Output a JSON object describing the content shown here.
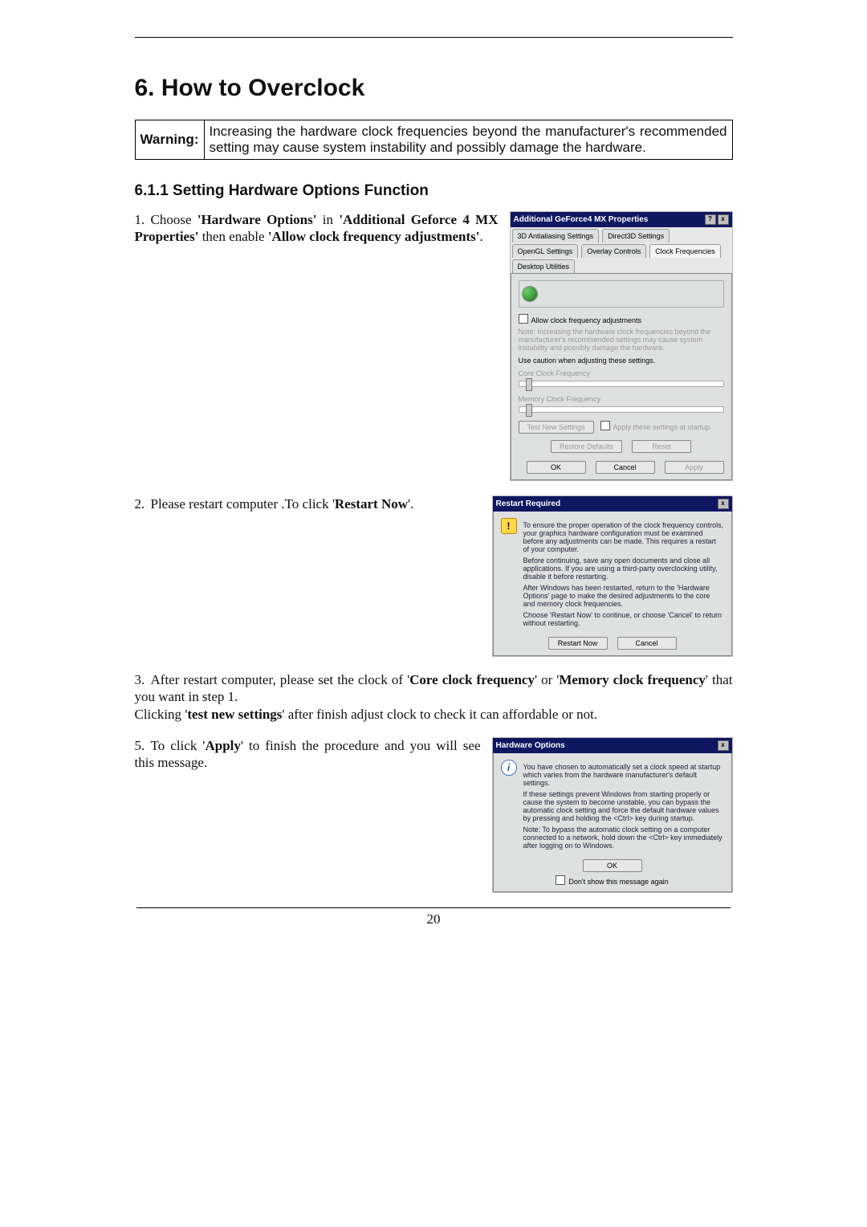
{
  "section": {
    "number": "6.",
    "title": "How to Overclock"
  },
  "warning": {
    "label": "Warning:",
    "text": "Increasing the hardware clock frequencies beyond the manufacturer's recommended setting may cause system instability and possibly damage the hardware."
  },
  "subsection": {
    "number": "6.1.1",
    "title": "Setting Hardware Options Function"
  },
  "steps": {
    "s1": {
      "num": "1.",
      "lead": "Choose ",
      "b1": "'Hardware Options'",
      "mid1": " in ",
      "b2": "'Additional Geforce 4 MX Properties'",
      "mid2": " then enable ",
      "b3": "'Allow clock frequency adjustments'",
      "tail": "."
    },
    "s2": {
      "num": "2.",
      "lead": "Please restart computer .To click '",
      "b1": "Restart Now",
      "tail": "'."
    },
    "s3": {
      "num": "3.",
      "lead": "After restart computer, please set the clock of '",
      "b1": "Core clock frequency",
      "mid1": "' or '",
      "b2": "Memory clock frequency",
      "mid2": "' that you want in step 1.",
      "line2a": "Clicking '",
      "b3": "test new settings",
      "line2b": "' after finish adjust clock to check it can affordable or not."
    },
    "s5": {
      "num": "5.",
      "lead": "To click '",
      "b1": "Apply",
      "mid1": "' to finish the procedure and you will see this message."
    }
  },
  "fig1": {
    "title": "Additional GeForce4 MX Properties",
    "tabs": [
      "3D Antialiasing Settings",
      "Direct3D Settings",
      "OpenGL Settings",
      "Overlay Controls",
      "Clock Frequencies",
      "Desktop Utilities"
    ],
    "active_tab_index": 4,
    "allow_label": "Allow clock frequency adjustments",
    "note": "Note: Increasing the hardware clock frequencies beyond the manufacturer's recommended settings may cause system instability and possibly damage the hardware.",
    "caution": "Use caution when adjusting these settings.",
    "core_label": "Core Clock Frequency",
    "mem_label": "Memory Clock Frequency",
    "test_btn": "Test New Settings",
    "apply_at_startup": "Apply these settings at startup",
    "restore_btn": "Restore Defaults",
    "reset_btn": "Reset",
    "ok": "OK",
    "cancel": "Cancel",
    "apply": "Apply"
  },
  "fig2": {
    "title": "Restart Required",
    "p1": "To ensure the proper operation of the clock frequency controls, your graphics hardware configuration must be examined before any adjustments can be made. This requires a restart of your computer.",
    "p2": "Before continuing, save any open documents and close all applications. If you are using a third-party overclocking utility, disable it before restarting.",
    "p3": "After Windows has been restarted, return to the 'Hardware Options' page to make the desired adjustments to the core and memory clock frequencies.",
    "p4": "Choose 'Restart Now' to continue, or choose 'Cancel' to return without restarting.",
    "restart_btn": "Restart Now",
    "cancel_btn": "Cancel"
  },
  "fig3": {
    "title": "Hardware Options",
    "p1": "You have chosen to automatically set a clock speed at startup which varies from the hardware manufacturer's default settings.",
    "p2": "If these settings prevent Windows from starting properly or cause the system to become unstable, you can bypass the automatic clock setting and force the default hardware values by pressing and holding the <Ctrl> key during startup.",
    "p3": "Note: To bypass the automatic clock setting on a computer connected to a network, hold down the <Ctrl> key immediately after logging on to Windows.",
    "ok": "OK",
    "dont_show": "Don't show this message again"
  },
  "page_number": "20"
}
